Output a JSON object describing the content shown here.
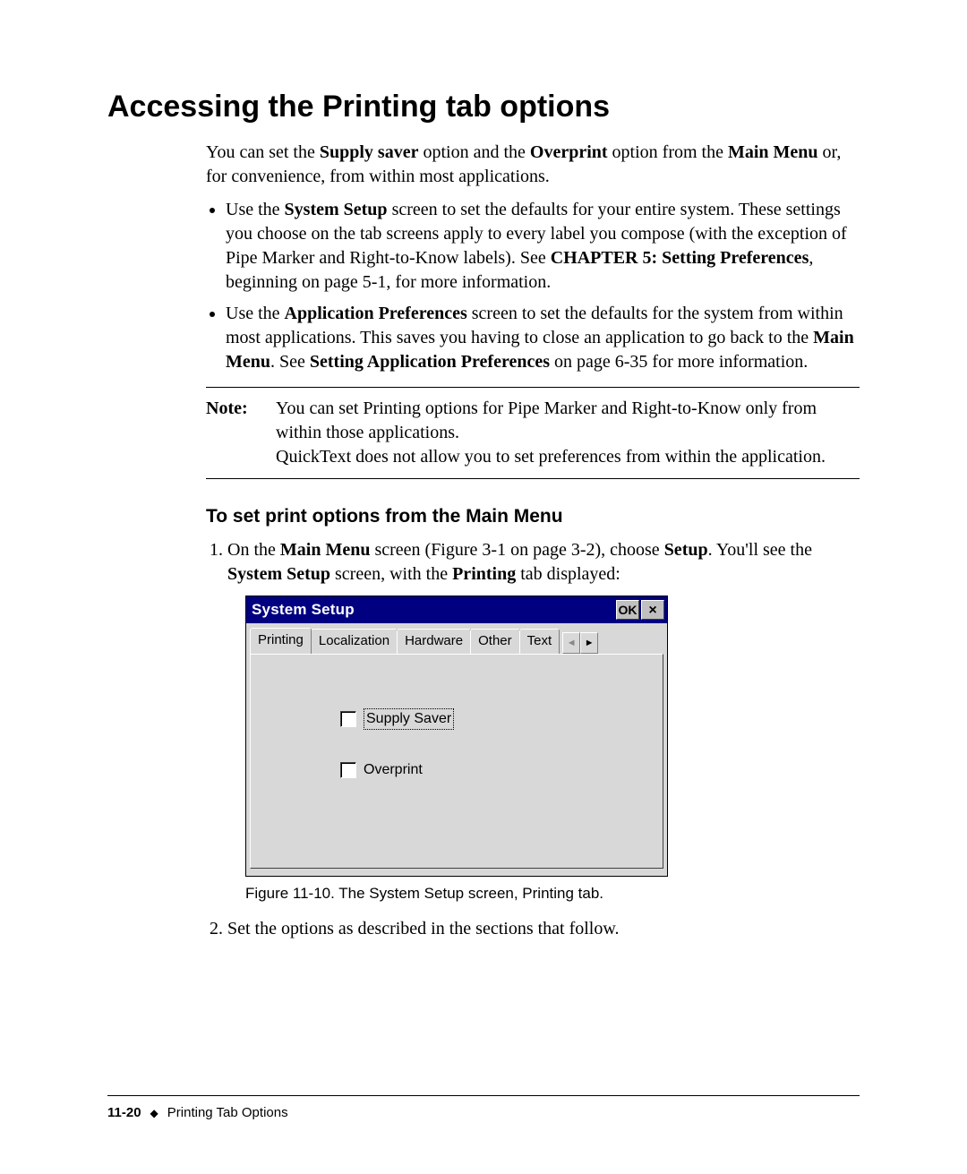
{
  "heading": "Accessing the Printing tab options",
  "intro": {
    "p1_pre": "You can set the ",
    "b1": "Supply saver",
    "p1_mid1": " option and the ",
    "b2": "Overprint",
    "p1_mid2": " option from the ",
    "b3": "Main Menu",
    "p1_post": " or, for convenience, from within most applications."
  },
  "bullets": {
    "b1_pre": "Use the ",
    "b1_b1": "System Setup",
    "b1_mid": " screen to set the defaults for your entire system. These settings you choose on the tab screens apply to every label you compose (with the exception of Pipe Marker and Right-to-Know labels). See ",
    "b1_b2": "CHAPTER 5: Setting Preferences",
    "b1_post": ", beginning on page 5-1, for more information.",
    "b2_pre": "Use the ",
    "b2_b1": "Application Preferences",
    "b2_mid1": " screen to set the defaults for the system from within most applications. This saves you having to close an application to go back to the ",
    "b2_b2": "Main Menu",
    "b2_mid2": ". See ",
    "b2_b3": "Setting Application Preferences",
    "b2_post": " on page 6-35 for more information."
  },
  "note": {
    "label": "Note:",
    "line1": "You can set Printing options for Pipe Marker and Right-to-Know only from within those applications.",
    "line2": "QuickText does not allow you to set preferences from within the application."
  },
  "subhead": "To set print options from the Main Menu",
  "step1": {
    "pre": "On the ",
    "b1": "Main Menu",
    "mid1": " screen (Figure 3-1 on page 3-2), choose ",
    "b2": "Setup",
    "mid2": ". You'll see the ",
    "b3": "System Setup",
    "mid3": " screen, with the ",
    "b4": "Printing",
    "post": " tab displayed:"
  },
  "window": {
    "title": "System Setup",
    "ok": "OK",
    "close": "×",
    "tabs": [
      "Printing",
      "Localization",
      "Hardware",
      "Other",
      "Text"
    ],
    "arrow_left": "◄",
    "arrow_right": "►",
    "chk1": "Supply Saver",
    "chk2": "Overprint"
  },
  "figcap": "Figure 11-10. The System Setup screen, Printing tab.",
  "step2": "Set the options as described in the sections that follow.",
  "footer": {
    "page": "11-20",
    "diamond": "◆",
    "section": "Printing Tab Options"
  }
}
